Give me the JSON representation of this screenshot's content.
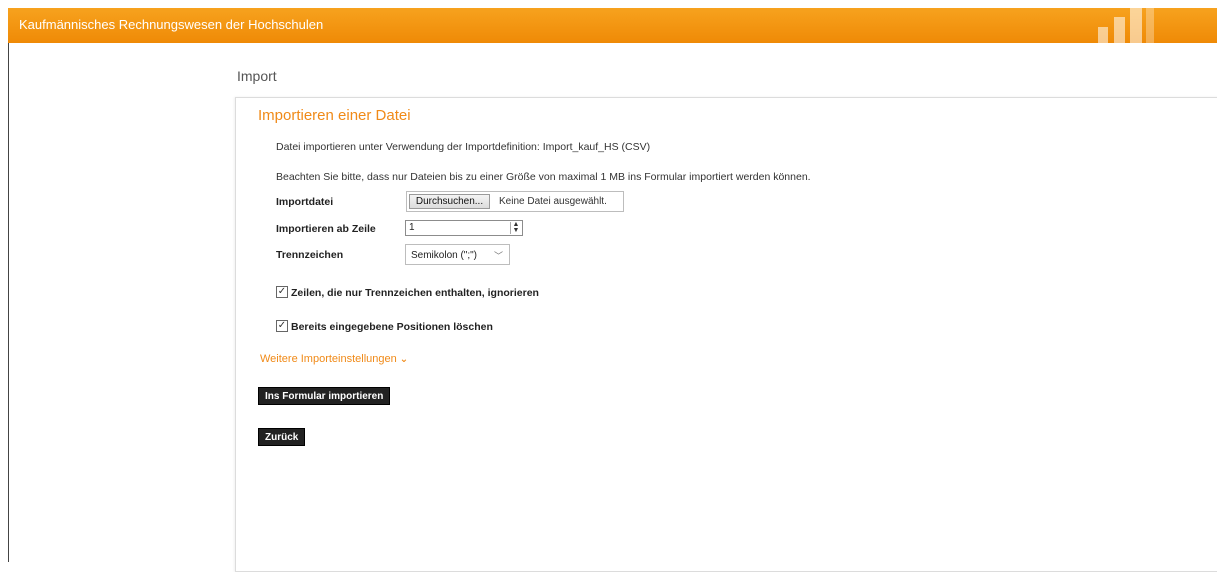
{
  "header": {
    "app_title": "Kaufmännisches Rechnungswesen der Hochschulen",
    "brand_color": "#ef8a06"
  },
  "page": {
    "title": "Import"
  },
  "panel": {
    "heading": "Importieren einer Datei",
    "definition_text": "Datei importieren unter Verwendung der Importdefinition: Import_kauf_HS (CSV)",
    "note_text": "Beachten Sie bitte, dass nur Dateien bis zu einer Größe von maximal 1 MB ins Formular importiert werden können.",
    "fields": {
      "importfile_label": "Importdatei",
      "browse_button": "Durchsuchen...",
      "file_status": "Keine Datei ausgewählt.",
      "start_row_label": "Importieren ab Zeile",
      "start_row_value": "1",
      "separator_label": "Trennzeichen",
      "separator_value": "Semikolon (\";\")"
    },
    "options": {
      "ignore_empty_label": "Zeilen, die nur Trennzeichen enthalten, ignorieren",
      "ignore_empty_checked": true,
      "delete_positions_label": "Bereits eingegebene Positionen löschen",
      "delete_positions_checked": true
    },
    "more_settings_link": "Weitere Importeinstellungen",
    "buttons": {
      "import": "Ins Formular importieren",
      "back": "Zurück"
    }
  }
}
